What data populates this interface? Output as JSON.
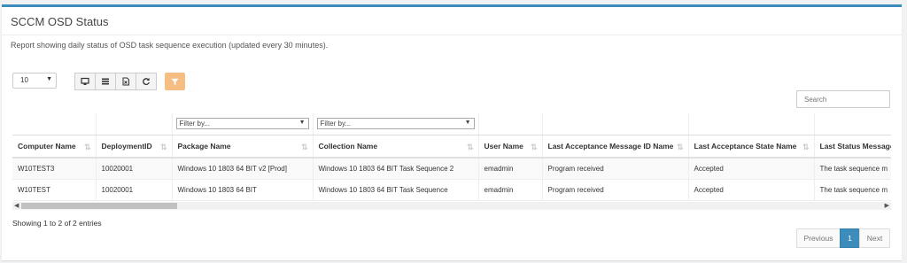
{
  "panel": {
    "title": "SCCM OSD Status",
    "description": "Report showing daily status of OSD task sequence execution (updated every 30 minutes)."
  },
  "length_select": {
    "value": "10"
  },
  "toolbar": {
    "buttons": [
      {
        "icon": "monitor-icon"
      },
      {
        "icon": "list-icon"
      },
      {
        "icon": "excel-file-icon"
      },
      {
        "icon": "refresh-icon"
      }
    ],
    "filter_icon": "filter-icon",
    "accent": "#f7be84"
  },
  "search": {
    "placeholder": "Search"
  },
  "filters": {
    "package": "Filter by...",
    "collection": "Filter by..."
  },
  "table": {
    "headers": [
      "Computer Name",
      "DeploymentID",
      "Package Name",
      "Collection Name",
      "User Name",
      "Last Acceptance Message ID Name",
      "Last Acceptance State Name",
      "Last Status Message"
    ],
    "rows": [
      [
        "W10TEST3",
        "10020001",
        "Windows 10 1803 64 BIT v2 [Prod]",
        "Windows 10 1803 64 BIT Task Sequence 2",
        "emadmin",
        "Program received",
        "Accepted",
        "The task sequence m"
      ],
      [
        "W10TEST",
        "10020001",
        "Windows 10 1803 64 BIT",
        "Windows 10 1803 64 BIT Task Sequence",
        "emadmin",
        "Program received",
        "Accepted",
        "The task sequence m"
      ]
    ]
  },
  "info": "Showing 1 to 2 of 2 entries",
  "pagination": {
    "previous": "Previous",
    "current": "1",
    "next": "Next",
    "active_color": "#3c8dbc"
  }
}
